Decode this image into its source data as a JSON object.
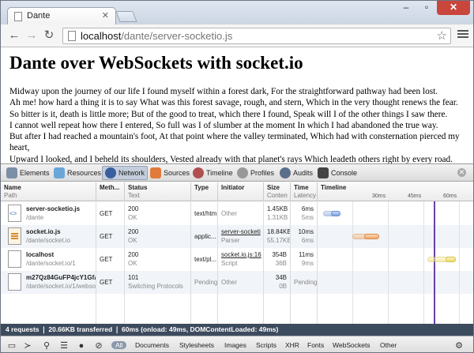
{
  "browser": {
    "tab_title": "Dante",
    "url_host": "localhost",
    "url_path": "/dante/server-socketio.js"
  },
  "page": {
    "title": "Dante over WebSockets with socket.io",
    "lines": [
      "Midway upon the journey of our life I found myself within a forest dark, For the straightforward pathway had been lost.",
      "Ah me! how hard a thing it is to say What was this forest savage, rough, and stern, Which in the very thought renews the fear.",
      "So bitter is it, death is little more; But of the good to treat, which there I found, Speak will I of the other things I saw there.",
      "I cannot well repeat how there I entered, So full was I of slumber at the moment In which I had abandoned the true way.",
      "But after I had reached a mountain's foot, At that point where the valley terminated, Which had with consternation pierced my heart,",
      "Upward I looked, and I beheld its shoulders, Vested already with that planet's rays Which leadeth others right by every road."
    ]
  },
  "devtools": {
    "panels": [
      "Elements",
      "Resources",
      "Network",
      "Sources",
      "Timeline",
      "Profiles",
      "Audits",
      "Console"
    ],
    "active_panel": "Network",
    "columns": {
      "name": {
        "title": "Name",
        "sub": "Path"
      },
      "method": {
        "title": "Meth..."
      },
      "status": {
        "title": "Status",
        "sub": "Text"
      },
      "type": {
        "title": "Type"
      },
      "initiator": {
        "title": "Initiator"
      },
      "size": {
        "title": "Size",
        "sub": "Conten"
      },
      "time": {
        "title": "Time",
        "sub": "Latency"
      },
      "timeline": {
        "title": "Timeline"
      }
    },
    "timeline_ticks": [
      "30ms",
      "45ms",
      "60ms"
    ],
    "rows": [
      {
        "name": "server-socketio.js",
        "path": "/dante",
        "method": "GET",
        "status": "200",
        "status_text": "OK",
        "type": "text/html",
        "initiator": "Other",
        "initiator_sub": "",
        "size": "1.45KB",
        "content": "1.31KB",
        "time": "6ms",
        "latency": "5ms"
      },
      {
        "name": "socket.io.js",
        "path": "/dante/socket.io",
        "method": "GET",
        "status": "200",
        "status_text": "OK",
        "type": "applic...",
        "initiator": "server-socketi",
        "initiator_sub": "Parser",
        "size": "18.84KB",
        "content": "55.17KB",
        "time": "10ms",
        "latency": "6ms"
      },
      {
        "name": "localhost",
        "path": "/dante/socket.io/1",
        "method": "GET",
        "status": "200",
        "status_text": "OK",
        "type": "text/pl...",
        "initiator": "socket.io.js:16",
        "initiator_sub": "Script",
        "size": "354B",
        "content": "36B",
        "time": "11ms",
        "latency": "9ms"
      },
      {
        "name": "m27Qz84GuFP4jcY1GfA",
        "path": "/dante/socket.io/1/webso",
        "method": "GET",
        "status": "101",
        "status_text": "Switching Protocols",
        "type": "Pending",
        "initiator": "Other",
        "initiator_sub": "",
        "size": "34B",
        "content": "0B",
        "time": "Pending",
        "latency": ""
      }
    ],
    "summary": "4 requests  ❘  20.66KB transferred  ❘  60ms (onload: 49ms, DOMContentLoaded: 49ms)",
    "filters": [
      "All",
      "Documents",
      "Stylesheets",
      "Images",
      "Scripts",
      "XHR",
      "Fonts",
      "WebSockets",
      "Other"
    ],
    "active_filter": "All"
  }
}
